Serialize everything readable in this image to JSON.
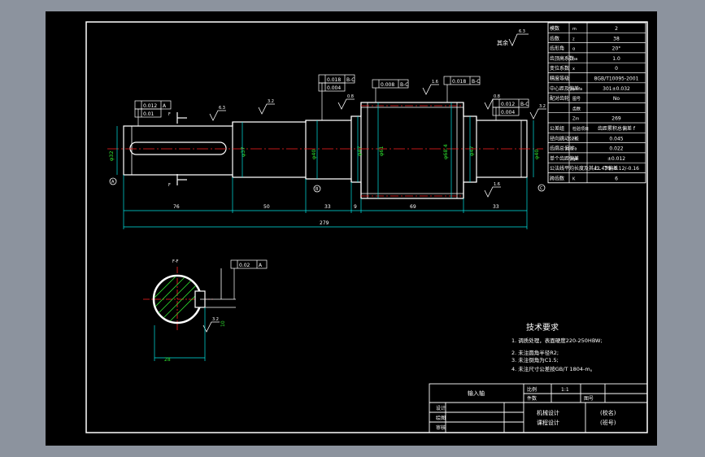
{
  "colors": {
    "background": "#8c939e",
    "sheet": "#000000",
    "outline": "#ffffff",
    "center_line": "#ff2020",
    "dimension": "#00e5e5",
    "green_dim": "#2ee02e",
    "annotation": "#ffff00"
  },
  "surface_symbol": {
    "label": "其余",
    "value": "6.3"
  },
  "params_table": [
    {
      "name": "模数",
      "sym": "m",
      "value": "2"
    },
    {
      "name": "齿数",
      "sym": "z",
      "value": "38"
    },
    {
      "name": "齿形角",
      "sym": "α",
      "value": "20°"
    },
    {
      "name": "齿顶高系数",
      "sym": "ha",
      "value": "1.0"
    },
    {
      "name": "变位系数",
      "sym": "x",
      "value": "0"
    },
    {
      "name": "精度等级",
      "sym": "",
      "value": "8GB/T10095-2001"
    },
    {
      "name": "中心距及偏差",
      "sym": "a±fa",
      "value": "301±0.032"
    },
    {
      "name": "配对齿轮",
      "sym": "图号",
      "value": "No"
    },
    {
      "name": "",
      "sym": "齿数",
      "value": ""
    },
    {
      "name": "",
      "sym": "Zm",
      "value": "269"
    },
    {
      "name": "公差组",
      "sym": "检验项目",
      "value": "齿距累积总偏差 f"
    },
    {
      "name": "径向跳动公差",
      "sym": "Fr",
      "value": "0.045"
    },
    {
      "name": "齿廓总偏差",
      "sym": "Fa",
      "value": "0.022"
    },
    {
      "name": "单个齿距偏差",
      "sym": "fpt",
      "value": "±0.012"
    },
    {
      "name": "公法线平均长度及其上、下偏差",
      "sym": "",
      "value": "42.439 -0.12/-0.16"
    },
    {
      "name": "跨齿数",
      "sym": "K",
      "value": "6"
    }
  ],
  "dimensions": {
    "d76": "76",
    "d50": "50",
    "d33a": "33",
    "d9": "9",
    "d69": "69",
    "d33b": "33",
    "total": "279",
    "dia1": "φ32",
    "dia2": "φ37",
    "dia3": "φ40",
    "dia4": "φ47",
    "dia5": "φ61",
    "dia6": "φ68.4",
    "dia7": "φ47",
    "dia8": "φ40",
    "key_depth": "28",
    "key_width": "10"
  },
  "tolerances": {
    "t1": "0.012",
    "t1_ref": "A",
    "t2": "0.01",
    "t3": "0.018",
    "t3_ref": "B-C",
    "t4": "0.004",
    "t5": "0.008",
    "t5_ref": "B-C",
    "t6": "0.018",
    "t6_ref": "B-C",
    "t7": "0.012",
    "t7_ref": "B-C",
    "t8": "0.004",
    "t9": "0.02",
    "t9_ref": "A"
  },
  "roughness": [
    "6.3",
    "3.2",
    "0.8",
    "1.6",
    "0.8",
    "3.2",
    "1.6",
    "3.2"
  ],
  "section_label": "F-F",
  "datum_labels": [
    "A",
    "B",
    "C"
  ],
  "tech_requirements": {
    "title": "技术要求",
    "items": [
      "1. 调质处理，表面硬度220-250HBW;",
      "2. 未注圆角半径R2;",
      "3. 未注倒角为C1.5;",
      "4. 未注尺寸公差按GB/T 1804-m。"
    ]
  },
  "title_block": {
    "part_name": "输入轴",
    "scale_label": "比例",
    "scale_value": "1:1",
    "material_label": "件数",
    "sheet_label": "图号",
    "designer": "设计",
    "drafter": "绘图",
    "checker": "审核",
    "course1": "机械设计",
    "course2": "课程设计",
    "school": "(校名)",
    "class": "(班号)"
  }
}
